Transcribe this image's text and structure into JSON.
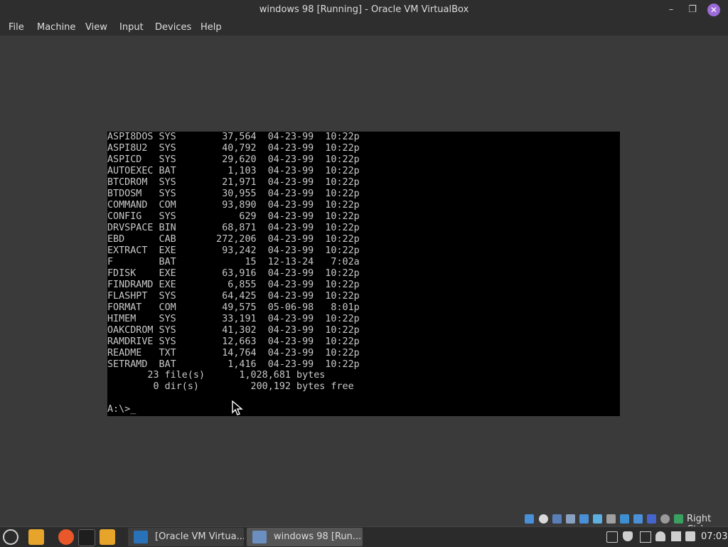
{
  "window": {
    "title": "windows 98 [Running] - Oracle VM VirtualBox",
    "minimize_glyph": "–",
    "maximize_glyph": "❐",
    "close_glyph": "✕"
  },
  "menu": {
    "items": [
      "File",
      "Machine",
      "View",
      "Input",
      "Devices",
      "Help"
    ]
  },
  "dos": {
    "files": [
      {
        "name": "ASPI8DOS",
        "ext": "SYS",
        "size": "37,564",
        "date": "04-23-99",
        "time": "10:22p"
      },
      {
        "name": "ASPI8U2",
        "ext": "SYS",
        "size": "40,792",
        "date": "04-23-99",
        "time": "10:22p"
      },
      {
        "name": "ASPICD",
        "ext": "SYS",
        "size": "29,620",
        "date": "04-23-99",
        "time": "10:22p"
      },
      {
        "name": "AUTOEXEC",
        "ext": "BAT",
        "size": "1,103",
        "date": "04-23-99",
        "time": "10:22p"
      },
      {
        "name": "BTCDROM",
        "ext": "SYS",
        "size": "21,971",
        "date": "04-23-99",
        "time": "10:22p"
      },
      {
        "name": "BTDOSM",
        "ext": "SYS",
        "size": "30,955",
        "date": "04-23-99",
        "time": "10:22p"
      },
      {
        "name": "COMMAND",
        "ext": "COM",
        "size": "93,890",
        "date": "04-23-99",
        "time": "10:22p"
      },
      {
        "name": "CONFIG",
        "ext": "SYS",
        "size": "629",
        "date": "04-23-99",
        "time": "10:22p"
      },
      {
        "name": "DRVSPACE",
        "ext": "BIN",
        "size": "68,871",
        "date": "04-23-99",
        "time": "10:22p"
      },
      {
        "name": "EBD",
        "ext": "CAB",
        "size": "272,206",
        "date": "04-23-99",
        "time": "10:22p"
      },
      {
        "name": "EXTRACT",
        "ext": "EXE",
        "size": "93,242",
        "date": "04-23-99",
        "time": "10:22p"
      },
      {
        "name": "F",
        "ext": "BAT",
        "size": "15",
        "date": "12-13-24",
        "time": "7:02a"
      },
      {
        "name": "FDISK",
        "ext": "EXE",
        "size": "63,916",
        "date": "04-23-99",
        "time": "10:22p"
      },
      {
        "name": "FINDRAMD",
        "ext": "EXE",
        "size": "6,855",
        "date": "04-23-99",
        "time": "10:22p"
      },
      {
        "name": "FLASHPT",
        "ext": "SYS",
        "size": "64,425",
        "date": "04-23-99",
        "time": "10:22p"
      },
      {
        "name": "FORMAT",
        "ext": "COM",
        "size": "49,575",
        "date": "05-06-98",
        "time": "8:01p"
      },
      {
        "name": "HIMEM",
        "ext": "SYS",
        "size": "33,191",
        "date": "04-23-99",
        "time": "10:22p"
      },
      {
        "name": "OAKCDROM",
        "ext": "SYS",
        "size": "41,302",
        "date": "04-23-99",
        "time": "10:22p"
      },
      {
        "name": "RAMDRIVE",
        "ext": "SYS",
        "size": "12,663",
        "date": "04-23-99",
        "time": "10:22p"
      },
      {
        "name": "README",
        "ext": "TXT",
        "size": "14,764",
        "date": "04-23-99",
        "time": "10:22p"
      },
      {
        "name": "SETRAMD",
        "ext": "BAT",
        "size": "1,416",
        "date": "04-23-99",
        "time": "10:22p"
      }
    ],
    "summary_files": "       23 file(s)      1,028,681 bytes",
    "summary_dirs": "        0 dir(s)         200,192 bytes free",
    "prompt": "A:\\>",
    "cursor": "_"
  },
  "status": {
    "host_key": "Right Ctrl",
    "icons": [
      "hard-disk-icon",
      "optical-disk-icon",
      "floppy-icon",
      "audio-icon",
      "network-icon",
      "usb-icon",
      "shared-folder-icon",
      "display-icon",
      "recording-icon",
      "vt-x-icon",
      "mouse-integration-icon",
      "keyboard-icon"
    ]
  },
  "taskbar": {
    "tasks": [
      "[Oracle VM Virtua...",
      "windows 98 [Run..."
    ],
    "clock": "07:03"
  },
  "colors": {
    "accent": "#9c6bd8",
    "dos_text": "#c8c8c8",
    "dos_bg": "#000000"
  }
}
